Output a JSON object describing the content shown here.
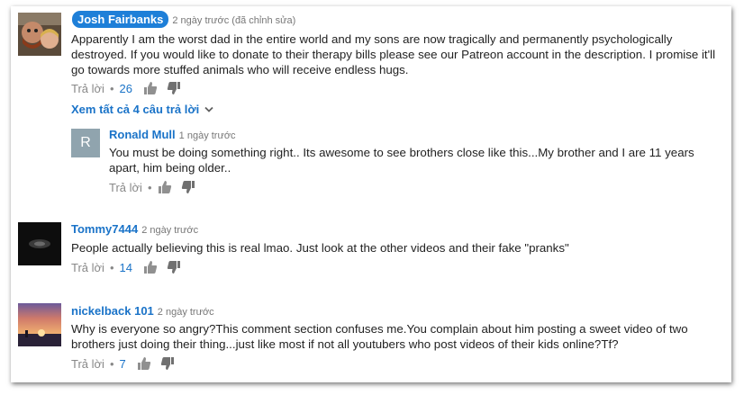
{
  "comments": [
    {
      "author": "Josh Fairbanks",
      "time": "2 ngày trước (đã chỉnh sửa)",
      "text": "Apparently I am the worst dad in the entire world and my sons are now tragically and permanently psychologically destroyed. If you would like to donate to their therapy bills please see our Patreon account in the description. I promise it'll go towards more stuffed animals who will receive endless hugs.",
      "reply_label": "Trả lời",
      "likes": "26",
      "view_replies": "Xem tất cả 4 câu trả lời",
      "reply": {
        "avatar_letter": "R",
        "author": "Ronald Mull",
        "time": "1 ngày trước",
        "text": "You must be doing something right.. Its awesome to see brothers close like this...My brother and I are 11 years apart, him being older..",
        "reply_label": "Trả lời"
      }
    },
    {
      "author": "Tommy7444",
      "time": "2 ngày trước",
      "text": "People actually believing this is real lmao. Just look at the other videos and their fake \"pranks\"",
      "reply_label": "Trả lời",
      "likes": "14"
    },
    {
      "author": "nickelback 101",
      "time": "2 ngày trước",
      "text": "Why is everyone so angry?This comment section confuses me.You complain about him posting a sweet video of two brothers just doing their thing...just like most if not all youtubers who post videos of their kids online?Tf?",
      "reply_label": "Trả lời",
      "likes": "7"
    }
  ],
  "colors": {
    "link": "#1a73c8",
    "badge": "#1e7fd8",
    "reply_avatar": "#90a4ae"
  },
  "icons": [
    "thumb-up-icon",
    "thumb-down-icon",
    "chevron-down-icon"
  ]
}
